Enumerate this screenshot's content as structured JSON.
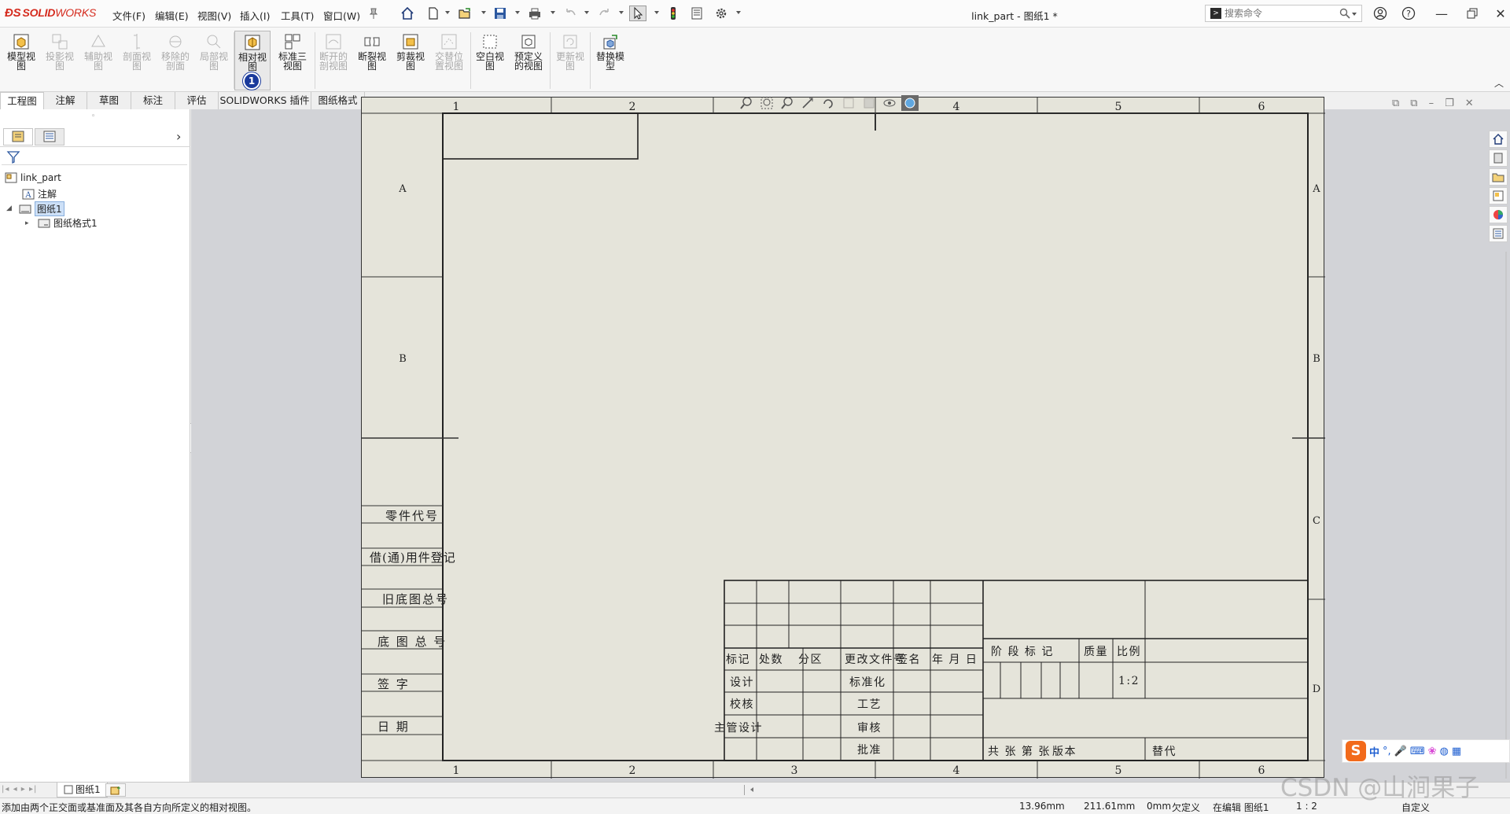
{
  "app": {
    "logo": "SOLIDWORKS",
    "logo_solid": "SOLID",
    "logo_works": "WORKS",
    "document_title": "link_part - 图纸1 *"
  },
  "menu": {
    "items": [
      "文件(F)",
      "编辑(E)",
      "视图(V)",
      "插入(I)",
      "工具(T)",
      "窗口(W)"
    ]
  },
  "search": {
    "placeholder": "搜索命令"
  },
  "ribbon": {
    "buttons": [
      {
        "label": "模型视图",
        "enabled": true,
        "icon": "model-view-icon"
      },
      {
        "label": "投影视图",
        "enabled": false,
        "icon": "projected-view-icon"
      },
      {
        "label": "辅助视图",
        "enabled": false,
        "icon": "auxiliary-view-icon"
      },
      {
        "label": "剖面视图",
        "enabled": false,
        "icon": "section-view-icon"
      },
      {
        "label": "移除的剖面",
        "enabled": false,
        "icon": "removed-section-icon"
      },
      {
        "label": "局部视图",
        "enabled": false,
        "icon": "detail-view-icon"
      },
      {
        "label": "相对视图",
        "enabled": true,
        "icon": "relative-view-icon",
        "selected": true
      },
      {
        "label": "标准三视图",
        "enabled": true,
        "icon": "standard-3view-icon"
      },
      {
        "label": "断开的剖视图",
        "enabled": false,
        "icon": "broken-out-section-icon"
      },
      {
        "label": "断裂视图",
        "enabled": true,
        "icon": "break-view-icon"
      },
      {
        "label": "剪裁视图",
        "enabled": true,
        "icon": "crop-view-icon"
      },
      {
        "label": "交替位置视图",
        "enabled": false,
        "icon": "alternate-position-icon"
      },
      {
        "label": "空白视图",
        "enabled": true,
        "icon": "empty-view-icon"
      },
      {
        "label": "预定义的视图",
        "enabled": true,
        "icon": "predefined-view-icon"
      },
      {
        "label": "更新视图",
        "enabled": false,
        "icon": "update-view-icon"
      },
      {
        "label": "替换模型",
        "enabled": true,
        "icon": "replace-model-icon"
      }
    ],
    "badge": "1"
  },
  "tabs": [
    "工程图",
    "注解",
    "草图",
    "标注",
    "评估",
    "SOLIDWORKS 插件",
    "图纸格式"
  ],
  "tree": {
    "root": "link_part",
    "annotations": "注解",
    "sheet": "图纸1",
    "sheet_format": "图纸格式1"
  },
  "drawing": {
    "columns_top": [
      "1",
      "2",
      "3",
      "4",
      "5",
      "6"
    ],
    "rows": [
      "A",
      "B",
      "C",
      "D"
    ],
    "left_table": [
      "零件代号",
      "借(通)用件登记",
      "旧底图总号",
      "底 图 总 号",
      "签 字",
      "日 期"
    ],
    "title_block": {
      "headers": [
        "标记",
        "处数",
        "分区",
        "更改文件号",
        "签名",
        "年 月 日"
      ],
      "row_design": [
        "设计",
        "标准化"
      ],
      "row_check": [
        "校核",
        "工艺"
      ],
      "row_manager": [
        "主管设计",
        "审核"
      ],
      "row_approve": [
        "批准"
      ],
      "stage": "阶 段 标 记",
      "mass": "质量",
      "scale_label": "比例",
      "scale_value": "1:2",
      "sheets": "共 张 第 张",
      "version": "版本",
      "replace": "替代"
    }
  },
  "sheet_tabs": {
    "active": "图纸1"
  },
  "status": {
    "message": "添加由两个正交面或基准面及其各自方向所定义的相对视图。",
    "x": "13.96mm",
    "y": "211.61mm",
    "z": "0mm",
    "underdefined": "欠定义",
    "editing": "在编辑 图纸1",
    "scale": "1 : 2",
    "custom": "自定义"
  },
  "ime": {
    "label": "中"
  },
  "watermark": "CSDN @山涧果子"
}
